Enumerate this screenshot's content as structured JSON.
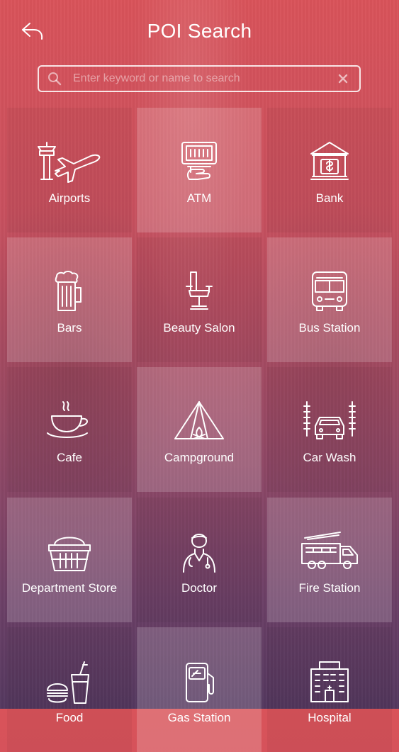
{
  "header": {
    "title": "POI Search"
  },
  "search": {
    "placeholder": "Enter keyword or name to search",
    "value": ""
  },
  "categories": [
    {
      "label": "Airports",
      "icon": "airport-icon"
    },
    {
      "label": "ATM",
      "icon": "atm-icon"
    },
    {
      "label": "Bank",
      "icon": "bank-icon"
    },
    {
      "label": "Bars",
      "icon": "beer-mug-icon"
    },
    {
      "label": "Beauty Salon",
      "icon": "salon-chair-icon"
    },
    {
      "label": "Bus Station",
      "icon": "bus-icon"
    },
    {
      "label": "Cafe",
      "icon": "coffee-cup-icon"
    },
    {
      "label": "Campground",
      "icon": "tent-icon"
    },
    {
      "label": "Car Wash",
      "icon": "car-wash-icon"
    },
    {
      "label": "Department Store",
      "icon": "shopping-basket-icon"
    },
    {
      "label": "Doctor",
      "icon": "doctor-icon"
    },
    {
      "label": "Fire Station",
      "icon": "fire-truck-icon"
    },
    {
      "label": "Food",
      "icon": "burger-drink-icon"
    },
    {
      "label": "Gas Station",
      "icon": "gas-pump-icon"
    },
    {
      "label": "Hospital",
      "icon": "hospital-icon"
    }
  ]
}
